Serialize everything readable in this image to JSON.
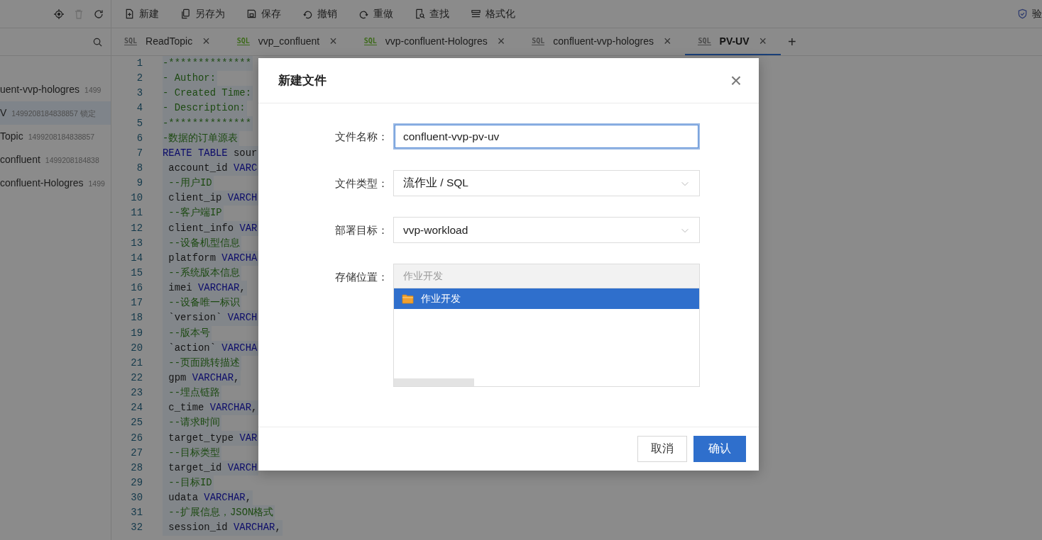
{
  "toolbar": {
    "tool_icons": [
      {
        "disabled": false
      },
      {
        "disabled": true
      },
      {
        "disabled": false
      }
    ],
    "actions": [
      {
        "label": "新建"
      },
      {
        "label": "另存为"
      },
      {
        "label": "保存"
      },
      {
        "label": "撤销"
      },
      {
        "label": "重做"
      },
      {
        "label": "查找"
      },
      {
        "label": "格式化"
      }
    ],
    "right_label": "验"
  },
  "tabs": [
    {
      "badge": "SQL",
      "color": "#4a4a4a",
      "label": "ReadTopic",
      "close": "×",
      "selected": false
    },
    {
      "badge": "SQL",
      "color": "#3d6a1a",
      "label": "vvp_confluent",
      "close": "×",
      "selected": false
    },
    {
      "badge": "SQL",
      "color": "#3d6a1a",
      "label": "vvp-confluent-Hologres",
      "close": "×",
      "selected": false
    },
    {
      "badge": "SQL",
      "color": "#4a4a4a",
      "label": "confluent-vvp-hologres",
      "close": "×",
      "selected": false
    },
    {
      "badge": "SQL",
      "color": "#4a4a4a",
      "label": "PV-UV",
      "close": "×",
      "selected": true
    }
  ],
  "add_tab": "+",
  "sidebar": {
    "items": [
      {
        "name": "uent-vvp-hologres",
        "id": "1499",
        "selected": false
      },
      {
        "name": "V",
        "id": "1499208184838857 锁定",
        "selected": true
      },
      {
        "name": "Topic",
        "id": "1499208184838857",
        "selected": false
      },
      {
        "name": "confluent",
        "id": "1499208184838",
        "selected": false
      },
      {
        "name": "confluent-Hologres",
        "id": "1499",
        "selected": false
      }
    ]
  },
  "editor": {
    "lines": [
      {
        "number": "1",
        "segments": [
          {
            "text": "-**************",
            "kind": "comment"
          }
        ]
      },
      {
        "number": "2",
        "segments": [
          {
            "text": "- Author:",
            "kind": "comment"
          }
        ]
      },
      {
        "number": "3",
        "segments": [
          {
            "text": "- Created Time:",
            "kind": "comment"
          }
        ]
      },
      {
        "number": "4",
        "segments": [
          {
            "text": "- Description:",
            "kind": "comment"
          }
        ]
      },
      {
        "number": "5",
        "segments": [
          {
            "text": "-**************",
            "kind": "comment"
          }
        ]
      },
      {
        "number": "6",
        "segments": [
          {
            "text": "-数据的订单源表",
            "kind": "comment"
          }
        ]
      },
      {
        "number": "7",
        "segments": [
          {
            "text": "REATE TABLE",
            "kind": "keyword"
          },
          {
            "text": " sour",
            "kind": "plain"
          }
        ]
      },
      {
        "number": "8",
        "segments": [
          {
            "text": " account_id ",
            "kind": "plain"
          },
          {
            "text": "VARC",
            "kind": "keyword"
          }
        ]
      },
      {
        "number": "9",
        "segments": [
          {
            "text": " --用户ID",
            "kind": "comment"
          }
        ]
      },
      {
        "number": "10",
        "segments": [
          {
            "text": " client_ip ",
            "kind": "plain"
          },
          {
            "text": "VARCH",
            "kind": "keyword"
          }
        ]
      },
      {
        "number": "11",
        "segments": [
          {
            "text": " --客户端IP",
            "kind": "comment"
          }
        ]
      },
      {
        "number": "12",
        "segments": [
          {
            "text": " client_info ",
            "kind": "plain"
          },
          {
            "text": "VAR",
            "kind": "keyword"
          }
        ]
      },
      {
        "number": "13",
        "segments": [
          {
            "text": " --设备机型信息",
            "kind": "comment"
          }
        ]
      },
      {
        "number": "14",
        "segments": [
          {
            "text": " platform ",
            "kind": "plain"
          },
          {
            "text": "VARCHA",
            "kind": "keyword"
          }
        ]
      },
      {
        "number": "15",
        "segments": [
          {
            "text": " --系统版本信息",
            "kind": "comment"
          }
        ]
      },
      {
        "number": "16",
        "segments": [
          {
            "text": " imei ",
            "kind": "plain"
          },
          {
            "text": "VARCHAR",
            "kind": "keyword"
          },
          {
            "text": ",",
            "kind": "plain"
          }
        ]
      },
      {
        "number": "17",
        "segments": [
          {
            "text": " --设备唯一标识",
            "kind": "comment"
          }
        ]
      },
      {
        "number": "18",
        "segments": [
          {
            "text": " `version` ",
            "kind": "plain"
          },
          {
            "text": "VARCH",
            "kind": "keyword"
          }
        ]
      },
      {
        "number": "19",
        "segments": [
          {
            "text": " --版本号",
            "kind": "comment"
          }
        ]
      },
      {
        "number": "20",
        "segments": [
          {
            "text": " `action` ",
            "kind": "plain"
          },
          {
            "text": "VARCHA",
            "kind": "keyword"
          }
        ]
      },
      {
        "number": "21",
        "segments": [
          {
            "text": " --页面跳转描述",
            "kind": "comment"
          }
        ]
      },
      {
        "number": "22",
        "segments": [
          {
            "text": " gpm ",
            "kind": "plain"
          },
          {
            "text": "VARCHAR",
            "kind": "keyword"
          },
          {
            "text": ",",
            "kind": "plain"
          }
        ]
      },
      {
        "number": "23",
        "segments": [
          {
            "text": " --埋点链路",
            "kind": "comment"
          }
        ]
      },
      {
        "number": "24",
        "segments": [
          {
            "text": " c_time ",
            "kind": "plain"
          },
          {
            "text": "VARCHAR",
            "kind": "keyword"
          },
          {
            "text": ",",
            "kind": "plain"
          }
        ]
      },
      {
        "number": "25",
        "segments": [
          {
            "text": " --请求时间",
            "kind": "comment"
          }
        ]
      },
      {
        "number": "26",
        "segments": [
          {
            "text": " target_type ",
            "kind": "plain"
          },
          {
            "text": "VAR",
            "kind": "keyword"
          }
        ]
      },
      {
        "number": "27",
        "segments": [
          {
            "text": " --目标类型",
            "kind": "comment"
          }
        ]
      },
      {
        "number": "28",
        "segments": [
          {
            "text": " target_id ",
            "kind": "plain"
          },
          {
            "text": "VARCH",
            "kind": "keyword"
          }
        ]
      },
      {
        "number": "29",
        "segments": [
          {
            "text": " --目标ID",
            "kind": "comment"
          }
        ]
      },
      {
        "number": "30",
        "segments": [
          {
            "text": " udata ",
            "kind": "plain"
          },
          {
            "text": "VARCHAR",
            "kind": "keyword"
          },
          {
            "text": ",",
            "kind": "plain"
          }
        ]
      },
      {
        "number": "31",
        "segments": [
          {
            "text": " --扩展信息，JSON格式",
            "kind": "comment"
          }
        ]
      },
      {
        "number": "32",
        "segments": [
          {
            "text": " session_id ",
            "kind": "plain"
          },
          {
            "text": "VARCHAR",
            "kind": "keyword"
          },
          {
            "text": ",",
            "kind": "plain"
          }
        ]
      }
    ]
  },
  "dialog": {
    "title": "新建文件",
    "close": "×",
    "fields": [
      {
        "kind": "input",
        "label": "文件名称：",
        "value": "confluent-vvp-pv-uv",
        "focused": true
      },
      {
        "kind": "select",
        "label": "文件类型：",
        "value": "流作业 / SQL"
      },
      {
        "kind": "select",
        "label": "部署目标：",
        "value": "vvp-workload"
      },
      {
        "kind": "tree",
        "label": "存储位置：",
        "path": "作业开发",
        "items": [
          {
            "label": "作业开发",
            "selected": true
          }
        ]
      }
    ],
    "buttons": [
      {
        "label": "取消",
        "primary": false
      },
      {
        "label": "确认",
        "primary": true
      }
    ]
  }
}
